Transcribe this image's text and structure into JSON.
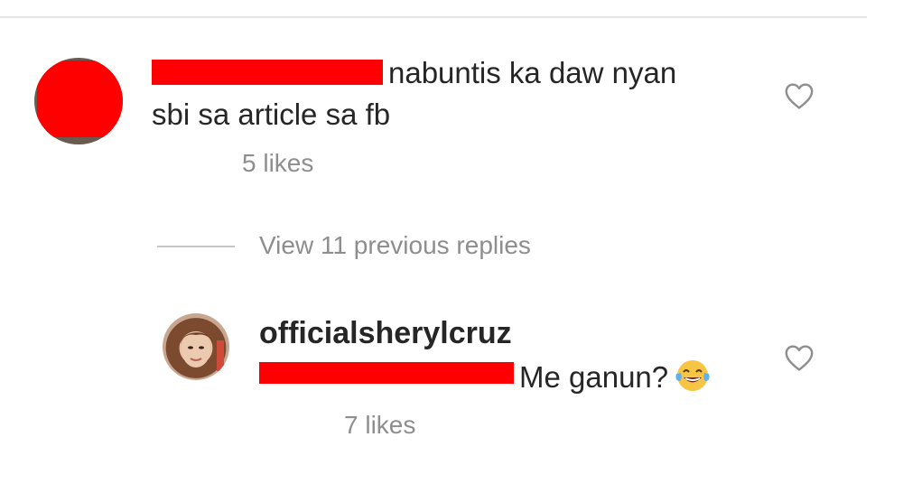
{
  "comment": {
    "text_line1": "nabuntis ka daw nyan",
    "text_line2": "sbi sa article sa fb",
    "likes": "5 likes",
    "redaction_color": "#ff0000"
  },
  "replies_toggle": {
    "label": "View 11 previous replies"
  },
  "reply": {
    "username": "officialsherylcruz",
    "text": "Me ganun?",
    "emoji": "face-with-tears-of-joy",
    "likes": "7 likes"
  },
  "colors": {
    "text": "#262626",
    "muted": "#8e8e8e",
    "divider": "#e6e6e6"
  }
}
